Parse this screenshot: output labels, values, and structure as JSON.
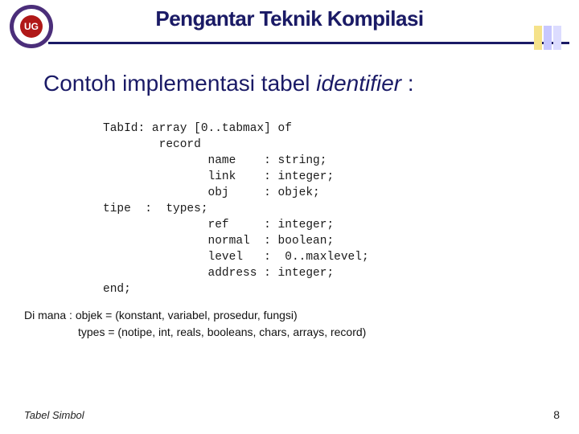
{
  "header": {
    "course_title": "Pengantar Teknik Kompilasi",
    "logo_text": "UG"
  },
  "slide": {
    "heading_prefix": "Contoh implementasi tabel ",
    "heading_italic": "identifier",
    "heading_suffix": " :"
  },
  "code": {
    "body": "TabId: array [0..tabmax] of\n        record\n               name    : string;\n               link    : integer;\n               obj     : objek;\ntipe  :  types;\n               ref     : integer;\n               normal  : boolean;\n               level   :  0..maxlevel;\n               address : integer;\nend;"
  },
  "notes": {
    "lead": "Di mana :",
    "line1": "objek = (konstant, variabel, prosedur, fungsi)",
    "line2": "types = (notipe, int, reals, booleans, chars, arrays, record)"
  },
  "footer": {
    "left": "Tabel Simbol",
    "page": "8"
  }
}
